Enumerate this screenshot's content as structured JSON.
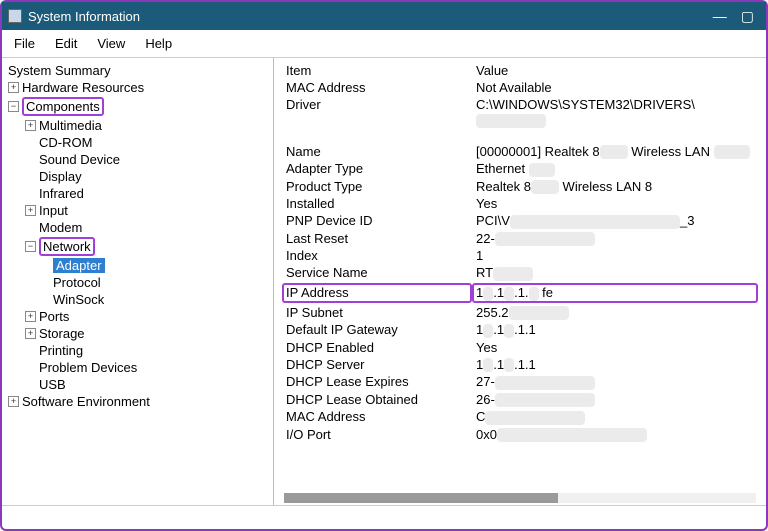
{
  "window": {
    "title": "System Information"
  },
  "menu": {
    "file": "File",
    "edit": "Edit",
    "view": "View",
    "help": "Help"
  },
  "tree": {
    "summary": "System Summary",
    "hardware": "Hardware Resources",
    "components": "Components",
    "multimedia": "Multimedia",
    "cdrom": "CD-ROM",
    "sound": "Sound Device",
    "display": "Display",
    "infrared": "Infrared",
    "input": "Input",
    "modem": "Modem",
    "network": "Network",
    "adapter": "Adapter",
    "protocol": "Protocol",
    "winsock": "WinSock",
    "ports": "Ports",
    "storage": "Storage",
    "printing": "Printing",
    "problem": "Problem Devices",
    "usb": "USB",
    "softenv": "Software Environment"
  },
  "header": {
    "item": "Item",
    "value": "Value"
  },
  "rows": {
    "mac_k": "MAC Address",
    "mac_v": "Not Available",
    "driver_k": "Driver",
    "driver_v": "C:\\WINDOWS\\SYSTEM32\\DRIVERS\\",
    "name_k": "Name",
    "name_v_a": "[00000001] Realtek 8",
    "name_v_b": "Wireless LAN",
    "atype_k": "Adapter Type",
    "atype_v": "Ethernet",
    "ptype_k": "Product Type",
    "ptype_v_a": "Realtek 8",
    "ptype_v_b": "Wireless LAN 8",
    "installed_k": "Installed",
    "installed_v": "Yes",
    "pnp_k": "PNP Device ID",
    "pnp_v_a": "PCI\\V",
    "pnp_v_b": "_3",
    "lastreset_k": "Last Reset",
    "lastreset_v": "22-",
    "index_k": "Index",
    "index_v": "1",
    "svc_k": "Service Name",
    "svc_v": "RT",
    "ip_k": "IP Address",
    "ip_v_a": "1",
    "ip_v_b": ".1",
    "ip_v_c": ".1.",
    "ip_v_d": "fe",
    "subnet_k": "IP Subnet",
    "subnet_v": "255.2",
    "gw_k": "Default IP Gateway",
    "gw_v_a": "1",
    "gw_v_b": ".1",
    "gw_v_c": ".1.1",
    "dhcp_k": "DHCP Enabled",
    "dhcp_v": "Yes",
    "dhcpsrv_k": "DHCP Server",
    "dhcpsrv_v_a": "1",
    "dhcpsrv_v_b": ".1",
    "dhcpsrv_v_c": ".1.1",
    "lexp_k": "DHCP Lease Expires",
    "lexp_v": "27-",
    "lobt_k": "DHCP Lease Obtained",
    "lobt_v": "26-",
    "mac2_k": "MAC Address",
    "mac2_v": "C",
    "ioport_k": "I/O Port",
    "ioport_v": "0x0"
  }
}
